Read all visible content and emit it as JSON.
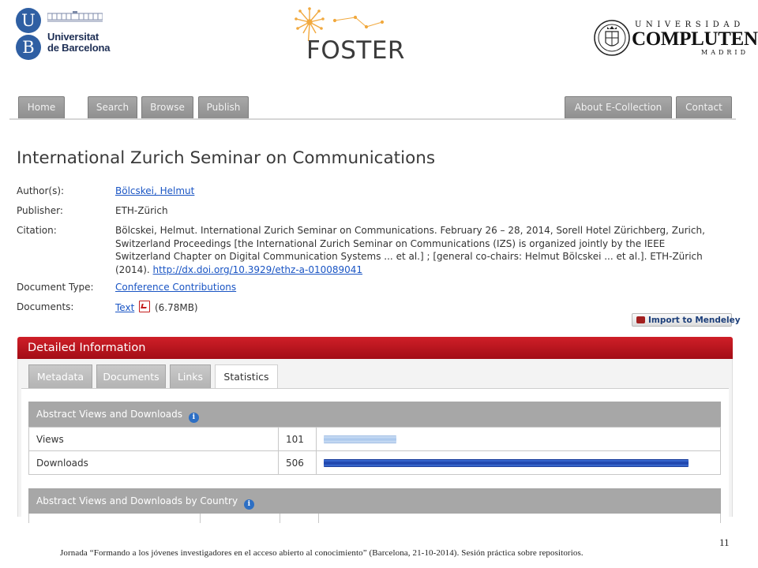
{
  "logos": {
    "ub": {
      "letter_top": "U",
      "letter_bottom": "B",
      "line1": "Universitat",
      "line2": "de Barcelona"
    },
    "foster": {
      "word": "FOSTER"
    },
    "ucm": {
      "line1": "UNIVERSIDAD",
      "line2": "COMPLUTENSE",
      "line3": "MADRID"
    }
  },
  "nav": {
    "home": "Home",
    "search": "Search",
    "browse": "Browse",
    "publish": "Publish",
    "about": "About E-Collection",
    "contact": "Contact"
  },
  "record": {
    "title": "International Zurich Seminar on Communications",
    "author_label": "Author(s):",
    "author_value": "Bölcskei, Helmut",
    "publisher_label": "Publisher:",
    "publisher_value": "ETH-Zürich",
    "citation_label": "Citation:",
    "citation_line1": "Bölcskei, Helmut. International Zurich Seminar on Communications. February 26 – 28, 2014, Sorell Hotel Zürichberg, Zurich,",
    "citation_line2": "Switzerland Proceedings [the International Zurich Seminar on Communications (IZS) is organized jointly by the IEEE",
    "citation_line3": "Switzerland Chapter on Digital Communication Systems ... et al.] ; [general co-chairs: Helmut Bölcskei ... et al.]. ETH-Zürich",
    "citation_line4_prefix": "(2014).",
    "citation_doi": "http://dx.doi.org/10.3929/ethz-a-010089041",
    "doctype_label": "Document Type:",
    "doctype_value": "Conference Contributions",
    "documents_label": "Documents:",
    "documents_link": "Text",
    "documents_size": "(6.78MB)",
    "mendeley_button": "Import to Mendeley"
  },
  "detail": {
    "header": "Detailed Information",
    "tabs": [
      "Metadata",
      "Documents",
      "Links",
      "Statistics"
    ],
    "active_tab": "Statistics",
    "stats_title": "Abstract Views and Downloads",
    "rows": [
      {
        "label": "Views",
        "count": "101",
        "value": 101
      },
      {
        "label": "Downloads",
        "count": "506",
        "value": 506
      }
    ],
    "country_title": "Abstract Views and Downloads by Country"
  },
  "colors": {
    "detail_header": "#b5141c",
    "nav_tab": "#9a9a9a",
    "link": "#1a55c4",
    "bar_views": "#a8c6ec",
    "bar_downloads": "#1b40a8"
  },
  "footer": {
    "text": "Jornada “Formando a los jóvenes investigadores en el acceso abierto al conocimiento” (Barcelona, 21-10-2014). Sesión práctica sobre repositorios.",
    "page_number": "11"
  }
}
